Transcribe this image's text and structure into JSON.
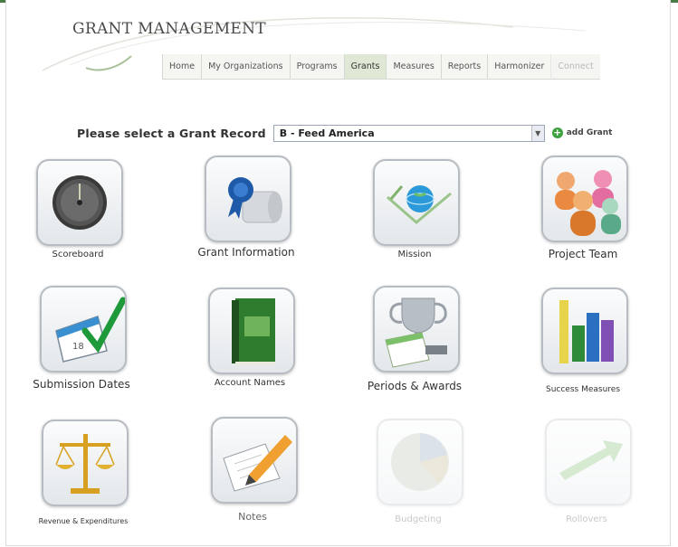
{
  "app": {
    "title": "GRANT MANAGEMENT"
  },
  "nav": {
    "tabs": [
      {
        "label": "Home"
      },
      {
        "label": "My Organizations"
      },
      {
        "label": "Programs"
      },
      {
        "label": "Grants",
        "active": true
      },
      {
        "label": "Measures"
      },
      {
        "label": "Reports"
      },
      {
        "label": "Harmonizer"
      },
      {
        "label": "Connect"
      }
    ]
  },
  "grant_select": {
    "label": "Please select a Grant Record",
    "value": "B - Feed America",
    "add_label": "add Grant"
  },
  "tiles": [
    {
      "label": "Scoreboard",
      "icon": "gauge-icon"
    },
    {
      "label": "Grant Information",
      "icon": "ribbon-scroll-icon"
    },
    {
      "label": "Mission",
      "icon": "globe-envelope-icon"
    },
    {
      "label": "Project Team",
      "icon": "people-group-icon"
    },
    {
      "label": "Submission Dates",
      "icon": "calendar-check-icon"
    },
    {
      "label": "Account Names",
      "icon": "green-book-icon"
    },
    {
      "label": "Periods & Awards",
      "icon": "trophy-calendar-icon"
    },
    {
      "label": "Success Measures",
      "icon": "bar-chart-icon"
    },
    {
      "label": "Revenue & Expenditures",
      "icon": "scales-icon"
    },
    {
      "label": "Notes",
      "icon": "pencil-paper-icon"
    },
    {
      "label": "Budgeting",
      "icon": "pie-chart-icon",
      "faded": true
    },
    {
      "label": "Rollovers",
      "icon": "arrow-icon",
      "faded": true
    }
  ],
  "colors": {
    "accent_green": "#4a7a46",
    "tab_active": "#dfe7d5"
  }
}
